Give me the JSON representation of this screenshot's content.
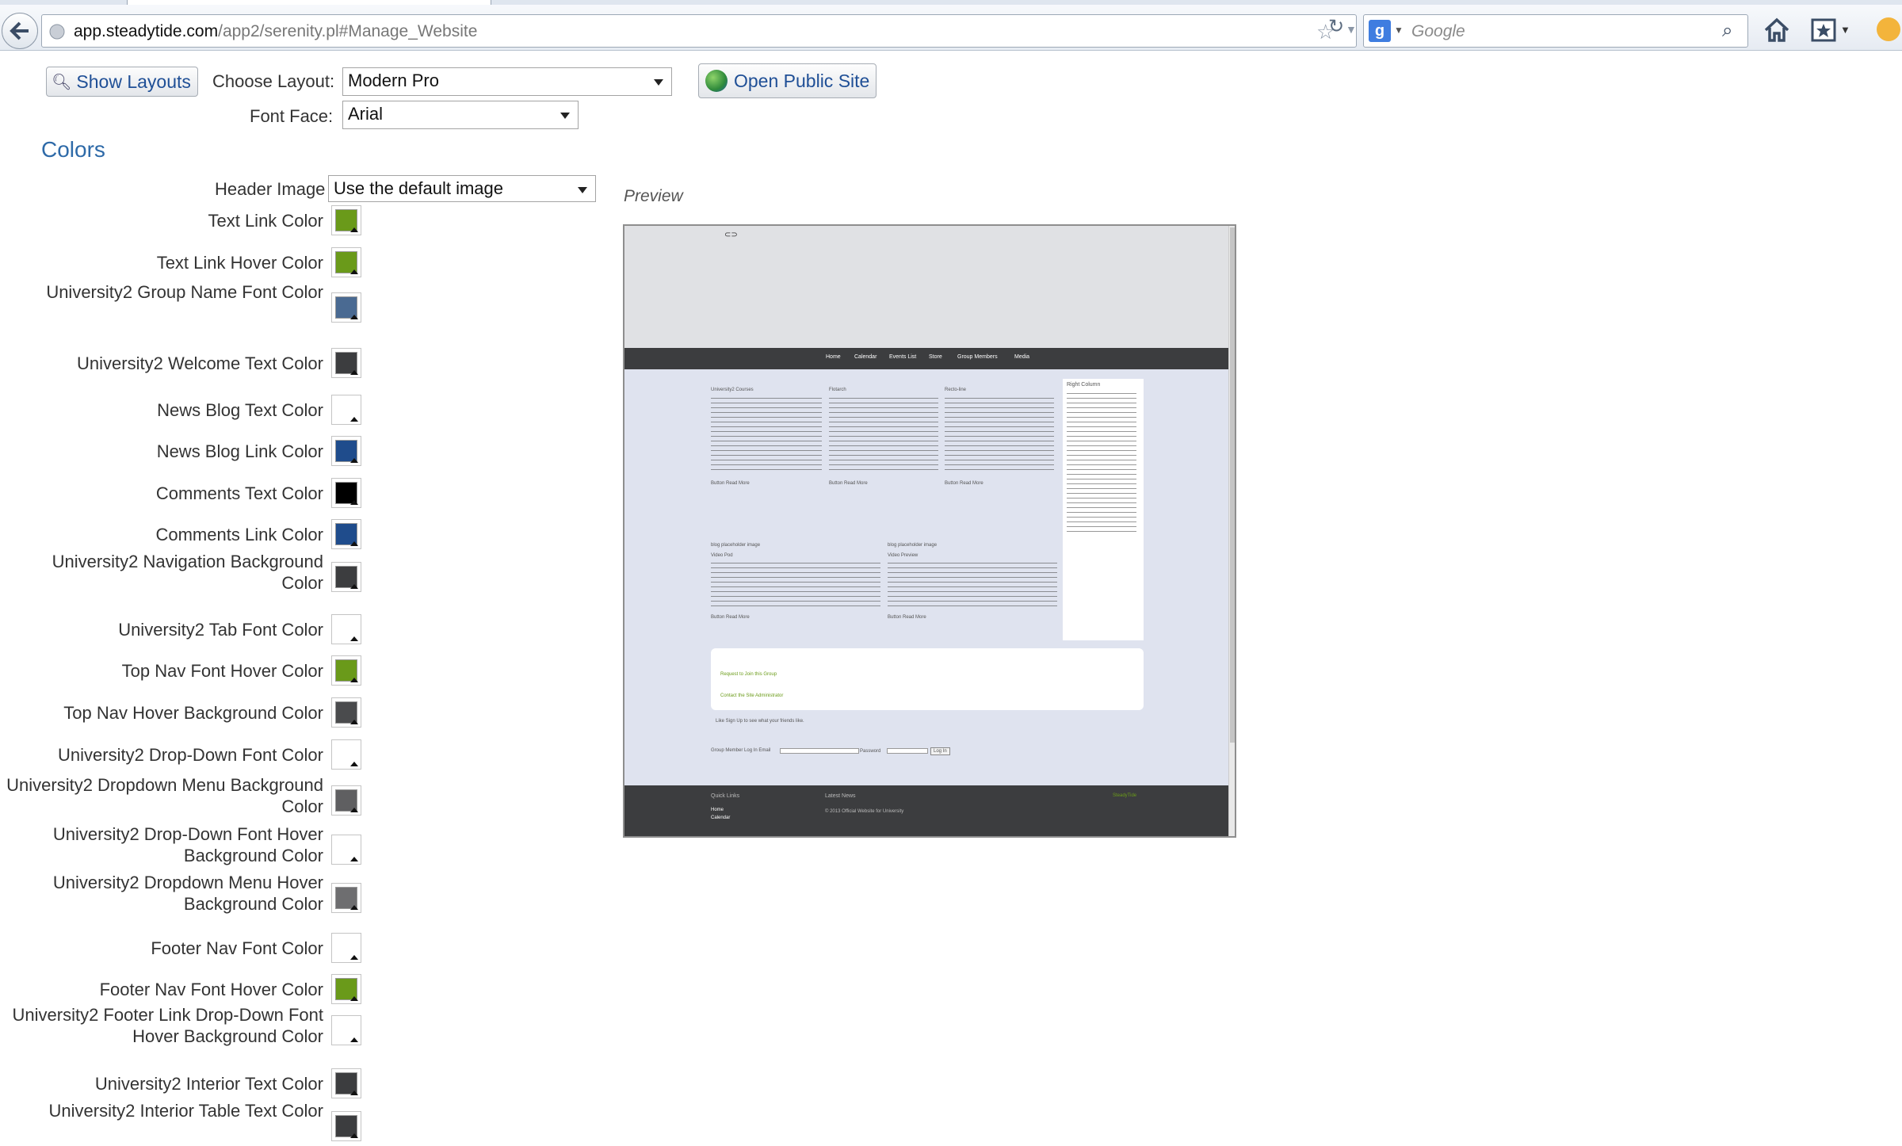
{
  "browser": {
    "url_domain": "app.steadytide.com",
    "url_path": "/app2/serenity.pl#Manage_Website",
    "search_placeholder": "Google",
    "search_engine_letter": "g"
  },
  "toolbar": {
    "show_layouts_label": "Show Layouts",
    "open_public_site_label": "Open Public Site"
  },
  "layout": {
    "choose_layout_label": "Choose Layout:",
    "choose_layout_value": "Modern Pro",
    "font_face_label": "Font Face:",
    "font_face_value": "Arial"
  },
  "colors": {
    "heading": "Colors",
    "header_image_label": "Header Image",
    "header_image_value": "Use the default image",
    "rows": [
      {
        "label": "Text Link Color",
        "color": "#6a9a1a"
      },
      {
        "label": "Text Link Hover Color",
        "color": "#6a9a1a"
      },
      {
        "label": "University2 Group Name Font Color",
        "color": "#4a6a92"
      },
      {
        "label": "University2 Welcome Text Color",
        "color": "#3c3d3f"
      },
      {
        "label": "News Blog Text Color",
        "color": "#ffffff"
      },
      {
        "label": "News Blog Link Color",
        "color": "#1f4c8c"
      },
      {
        "label": "Comments Text Color",
        "color": "#000000"
      },
      {
        "label": "Comments Link Color",
        "color": "#1f4c8c"
      },
      {
        "label": "University2 Navigation Background Color",
        "color": "#3c3d3f"
      },
      {
        "label": "University2 Tab Font Color",
        "color": "#ffffff"
      },
      {
        "label": "Top Nav Font Hover Color",
        "color": "#6a9a1a"
      },
      {
        "label": "Top Nav Hover Background Color",
        "color": "#4a4b4d"
      },
      {
        "label": "University2 Drop-Down Font Color",
        "color": "#ffffff"
      },
      {
        "label": "University2 Dropdown Menu Background Color",
        "color": "#5f5f61"
      },
      {
        "label": "University2 Drop-Down Font Hover Background Color",
        "color": "#ffffff"
      },
      {
        "label": "University2 Dropdown Menu Hover Background Color",
        "color": "#6e6e70"
      },
      {
        "label": "Footer Nav Font Color",
        "color": "#ffffff"
      },
      {
        "label": "Footer Nav Font Hover Color",
        "color": "#6a9a1a"
      },
      {
        "label": "University2 Footer Link Drop-Down Font Hover Background Color",
        "color": "#ffffff"
      },
      {
        "label": "University2 Interior Text Color",
        "color": "#3c3d3f"
      },
      {
        "label": "University2 Interior Table Text Color",
        "color": "#3c3d3f"
      }
    ]
  },
  "preview": {
    "label": "Preview",
    "nav_items": [
      "Home",
      "Calendar",
      "Events List",
      "Store",
      "Group Members",
      "Media"
    ],
    "columns": [
      "University2 Courses",
      "Flotarch",
      "Recto-line"
    ],
    "read_more": "Button Read More",
    "right_column_title": "Right Column",
    "media_titles": [
      "blog placeholder image",
      "blog placeholder image"
    ],
    "media_subtitles": [
      "Video Pod",
      "Video Preview"
    ],
    "join_link": "Request to Join this Group",
    "contact_link": "Contact the Site Administrator",
    "like_text": "Like   Sign Up to see what your friends like.",
    "login_label": "Group Member Log In   Email",
    "password_label": "Password",
    "login_button": "Log In",
    "footer_quick_links": "Quick Links",
    "footer_home": "Home",
    "footer_calendar": "Calendar",
    "footer_latest_news": "Latest News",
    "footer_copyright": "© 2013 Official Website for University",
    "footer_brand": "SteadyTide"
  }
}
